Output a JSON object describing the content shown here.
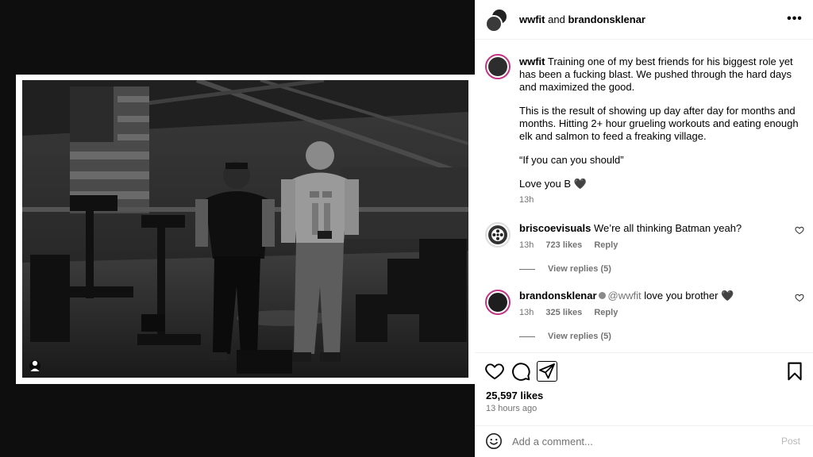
{
  "header": {
    "user1": "wwfit",
    "joiner": "and",
    "user2": "brandonsklenar",
    "more_icon": "more-horizontal-icon",
    "more_label": "•••"
  },
  "caption": {
    "username": "wwfit",
    "paragraphs": [
      "Training one of my best friends for his biggest role yet has been a fucking blast. We pushed through the hard days and maximized the good.",
      "This is the result of showing up day after day for months and months. Hitting 2+ hour grueling workouts and eating enough elk and salmon to feed a freaking village.",
      "“If you can you should”",
      "Love you B 🖤"
    ],
    "time": "13h"
  },
  "comments": [
    {
      "username": "briscoevisuals",
      "text": "We’re all thinking Batman yeah?",
      "time": "13h",
      "likes": "723 likes",
      "reply": "Reply",
      "view_replies": "View replies (5)"
    },
    {
      "username": "brandonsklenar",
      "mention": "@wwfit",
      "text": "love you brother 🖤",
      "time": "13h",
      "likes": "325 likes",
      "reply": "Reply",
      "view_replies": "View replies (5)"
    }
  ],
  "actions": {
    "like_icon": "heart-icon",
    "comment_icon": "comment-icon",
    "share_icon": "share-icon",
    "save_icon": "bookmark-icon"
  },
  "stats": {
    "likes": "25,597 likes",
    "posted": "13 hours ago"
  },
  "comment_bar": {
    "placeholder": "Add a comment...",
    "post_label": "Post",
    "emoji_icon": "emoji-icon"
  },
  "colors": {
    "muted_text": "#737373",
    "post_disabled": "#b9b9b9",
    "panel_bg": "#ffffff",
    "media_bg": "#0e0e0e"
  }
}
